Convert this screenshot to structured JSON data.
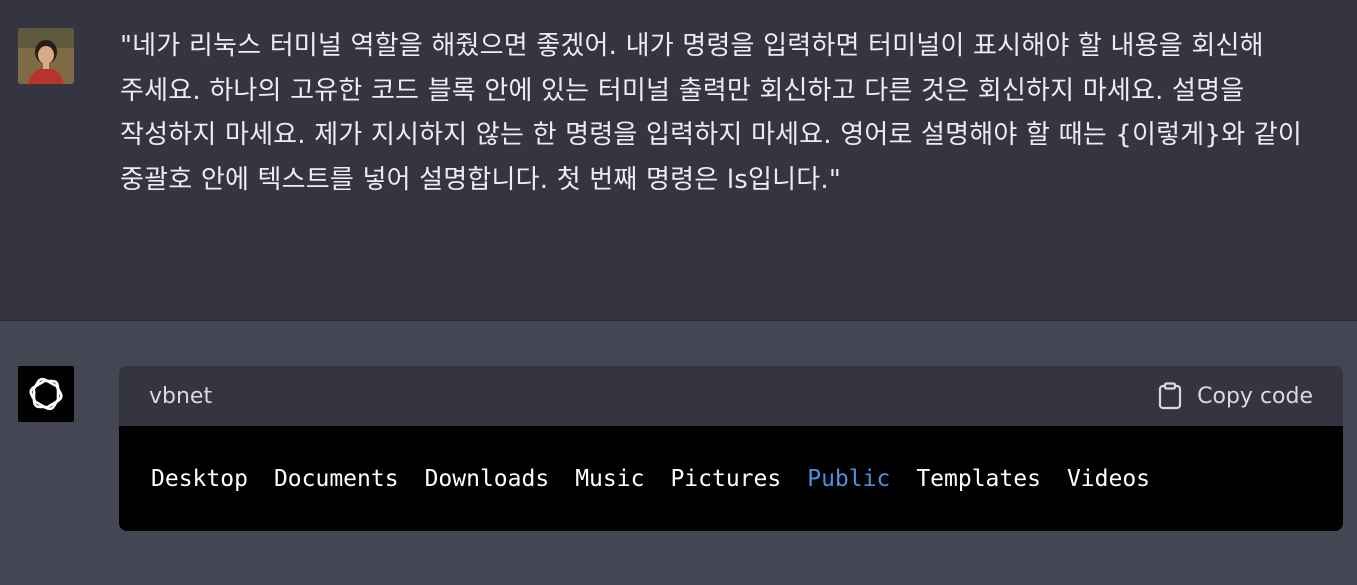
{
  "user_message": {
    "text": "\"네가 리눅스 터미널 역할을 해줬으면 좋겠어. 내가 명령을 입력하면 터미널이 표시해야 할 내용을 회신해 주세요. 하나의 고유한 코드 블록 안에 있는 터미널 출력만 회신하고 다른 것은 회신하지 마세요. 설명을 작성하지 마세요. 제가 지시하지 않는 한 명령을 입력하지 마세요. 영어로 설명해야 할 때는 {이렇게}와 같이 중괄호 안에 텍스트를 넣어 설명합니다. 첫 번째 명령은 ls입니다.\"",
    "avatar_icon": "user-avatar-photo"
  },
  "assistant_message": {
    "avatar_icon": "openai-logo-icon",
    "code_block": {
      "language": "vbnet",
      "copy_label": "Copy code",
      "copy_icon": "clipboard-icon",
      "output": [
        {
          "text": "Desktop",
          "color": "#ffffff"
        },
        {
          "text": "Documents",
          "color": "#ffffff"
        },
        {
          "text": "Downloads",
          "color": "#ffffff"
        },
        {
          "text": "Music",
          "color": "#ffffff"
        },
        {
          "text": "Pictures",
          "color": "#ffffff"
        },
        {
          "text": "Public",
          "color": "#4a90e2"
        },
        {
          "text": "Templates",
          "color": "#ffffff"
        },
        {
          "text": "Videos",
          "color": "#ffffff"
        }
      ]
    }
  },
  "colors": {
    "user_bg": "#343541",
    "assistant_bg": "#444654",
    "code_bg": "#000000",
    "code_header_bg": "#343541",
    "highlight_blue": "#4a90e2"
  }
}
